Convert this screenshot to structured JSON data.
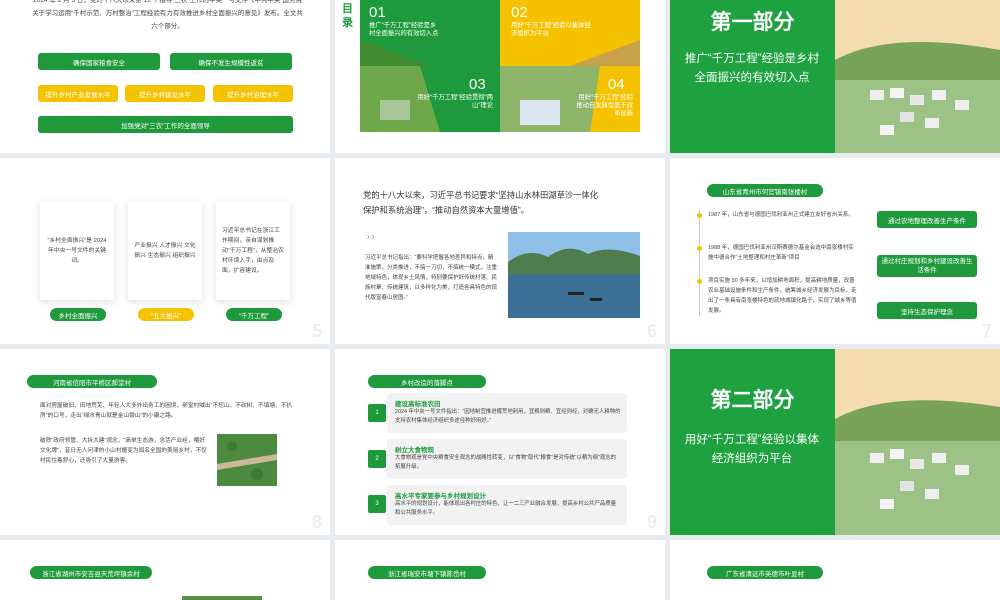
{
  "s1": {
    "intro": "2024 年 2 月 3 日，党的十八大以来第 12 个指导“三农”工作的中央一号文件《中共中央 国务院关于学习运用“千村示范、万村整治”工程经验有力有效推进乡村全面振兴的意见》发布。全文共六个部分。",
    "btn1": "确保国家粮食安全",
    "btn2": "确保不发生规模性返贫",
    "btn3": "提升乡村产业发展水平",
    "btn4": "提升乡村建设水平",
    "btn5": "提升乡村治理水平",
    "btn6": "加强党对“三农”工作的全面领导"
  },
  "s2": {
    "label": "目录",
    "items": [
      {
        "num": "01",
        "text": "推广“千万工程”经验是乡村全面振兴的有效切入点"
      },
      {
        "num": "02",
        "text": "用好“千万工程”经验以集体经济组织为平台"
      },
      {
        "num": "03",
        "text": "用好“千万工程”经验贯彻“两山”理论"
      },
      {
        "num": "04",
        "text": "用好“千万工程”经验推动自发典型盖于改革创新"
      }
    ]
  },
  "s3": {
    "title": "第一部分",
    "subtitle": "推广“千万工程”经验是乡村全面振兴的有效切入点"
  },
  "s4": {
    "card1": "“乡村全面振兴”是 2024 年中央一号文件的关键词。",
    "card2": "产业振兴 人才振兴 文化振兴 生态振兴 组织振兴",
    "card3": "习近平总书记在浙江工作期间，亲自谋划推动“千万工程”，从整治农村环境入手，由点及面，扩容建设。",
    "pill1": "乡村全面振兴",
    "pill2": "“五大振兴”",
    "pill3": "“千万工程”",
    "page": "5"
  },
  "s5": {
    "quote": "党的十八大以来，习近平总书记要求“坚持山水林田湖草沙一体化保护和系统治理”，“推动自然资本大量增值”。",
    "body": "习近平总书记指出：“要科学把握各地差异和特点，精准施策，分类推进，不搞一刀切，不搞统一模式，注重地域特色，体现乡土风情，特别要保护好传统村落、民族村寨、传统建筑，以多样化为美，打造各具特色的现代版富春山居图。”",
    "page": "6"
  },
  "s6": {
    "header": "山东省青州市何官镇南张楼村",
    "t1": "1987 年，山东省与德国巴伐利亚州正式建立友好省州关系。",
    "t2": "1988 年，德国巴伐利亚州汉斯赛德尔基金会选中南张楼村实施中德合作“土地整理和村庄革新”项目",
    "t3": "项目实施 30 多年来，以增加耕地面积，提高耕地质量，改善农业基础设施条件和生产条件，统筹城乡经济发展为目标，走出了一条具有南张楼特色的就地城镇化路子，实现了城乡等值发展。",
    "b1": "通过农地整理改善生产条件",
    "b2": "通过村庄规划和乡村建设改善生活条件",
    "b3": "坚持生态保护理念",
    "page": "7"
  },
  "s7": {
    "header": "河南省信阳市平桥区郝堂村",
    "p1": "面对房屋破旧、田地荒芜、年轻人大多外出务工的困境，郝堂村喊出“不挖山、不砍树、不填塘、不扒房”的口号，走出“绿水青山就是金山银山”的小康之路。",
    "p2": "破除“政府领管、大拆大建”观念，“简单生态游，念活产业经，嘲好文化牌”，昔日无人问津的小山村嬗变为闻名全国的美丽乡村，不仅村民住着舒心，还吸引了大量游客。",
    "page": "8"
  },
  "s8": {
    "header": "乡村改造的落脚点",
    "items": [
      {
        "num": "1",
        "title": "建设高标准农田",
        "text": "2024 年中央一号文件指出：“因地制宜推进撂荒地利用，宜粮则粮、宜经则经，对确无人耕种的支持农村集体经济组织多途径种好用好。”"
      },
      {
        "num": "2",
        "title": "树立大食物观",
        "text": "大食物观是党中央粮食安全观念的战略性转变，以“食物”取代“粮食”是对传统“以粮为纲”观念的拓展升级。"
      },
      {
        "num": "3",
        "title": "高水平专家要参与乡村规划设计",
        "text": "高水平的规划设计，能体现出各村庄的特色，让一二三产业融合发展，提高乡村公共产品质量和公共服务水平。"
      }
    ],
    "page": "9"
  },
  "s9": {
    "title": "第二部分",
    "subtitle": "用好“千万工程”经验以集体经济组织为平台"
  },
  "s10": {
    "header": "浙江省湖州市安吉县天荒坪镇余村"
  },
  "s11": {
    "header": "浙江省瑞安市塘下镇陈岙村"
  },
  "s12": {
    "header": "广东省清远市英德市叶显村"
  }
}
